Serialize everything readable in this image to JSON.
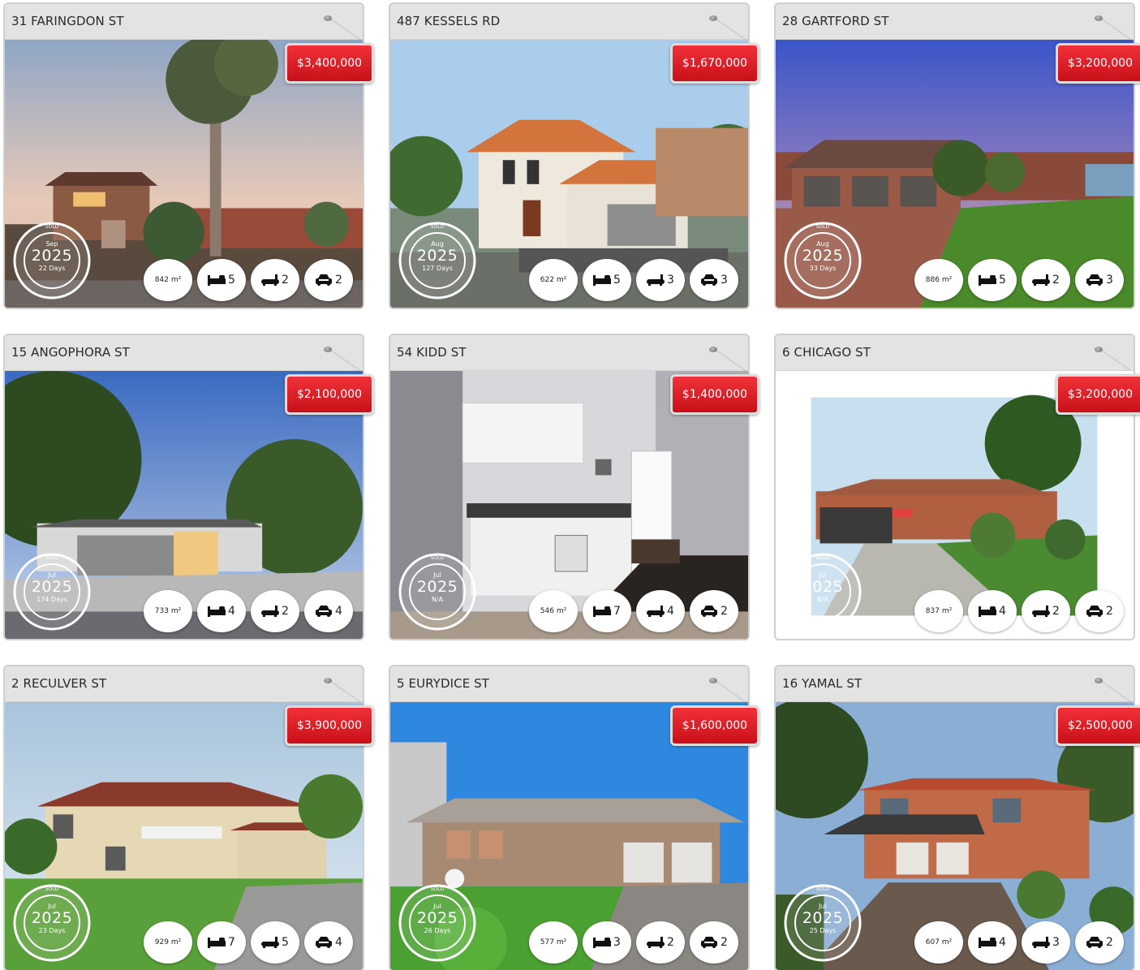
{
  "colors": {
    "price_red": "#e0202a",
    "header_gray": "#e3e3e3",
    "border": "#cfcfcf"
  },
  "icons": {
    "bed": "bed-icon",
    "bath": "bath-icon",
    "car": "car-icon"
  },
  "stamp_word": "SOLD",
  "listings": [
    {
      "address": "31 FARINGDON ST",
      "price": "$3,400,000",
      "month": "Sep",
      "year": "2025",
      "days": "22 Days",
      "land": "842 m²",
      "beds": "5",
      "baths": "2",
      "cars": "2"
    },
    {
      "address": "487 KESSELS RD",
      "price": "$1,670,000",
      "month": "Aug",
      "year": "2025",
      "days": "127 Days",
      "land": "622 m²",
      "beds": "5",
      "baths": "3",
      "cars": "3"
    },
    {
      "address": "28 GARTFORD ST",
      "price": "$3,200,000",
      "month": "Aug",
      "year": "2025",
      "days": "33 Days",
      "land": "886 m²",
      "beds": "5",
      "baths": "2",
      "cars": "3"
    },
    {
      "address": "15 ANGOPHORA ST",
      "price": "$2,100,000",
      "month": "Jul",
      "year": "2025",
      "days": "174 Days",
      "land": "733 m²",
      "beds": "4",
      "baths": "2",
      "cars": "4"
    },
    {
      "address": "54 KIDD ST",
      "price": "$1,400,000",
      "month": "Jul",
      "year": "2025",
      "days": "N/A",
      "land": "546 m²",
      "beds": "7",
      "baths": "4",
      "cars": "2"
    },
    {
      "address": "6 CHICAGO ST",
      "price": "$3,200,000",
      "month": "Jul",
      "year": "2025",
      "days": "N/A",
      "land": "837 m²",
      "beds": "4",
      "baths": "2",
      "cars": "2"
    },
    {
      "address": "2 RECULVER ST",
      "price": "$3,900,000",
      "month": "Jul",
      "year": "2025",
      "days": "23 Days",
      "land": "929 m²",
      "beds": "7",
      "baths": "5",
      "cars": "4"
    },
    {
      "address": "5 EURYDICE ST",
      "price": "$1,600,000",
      "month": "Jul",
      "year": "2025",
      "days": "26 Days",
      "land": "577 m²",
      "beds": "3",
      "baths": "2",
      "cars": "2"
    },
    {
      "address": "16 YAMAL ST",
      "price": "$2,500,000",
      "month": "Jul",
      "year": "2025",
      "days": "25 Days",
      "land": "607 m²",
      "beds": "4",
      "baths": "3",
      "cars": "2"
    }
  ]
}
